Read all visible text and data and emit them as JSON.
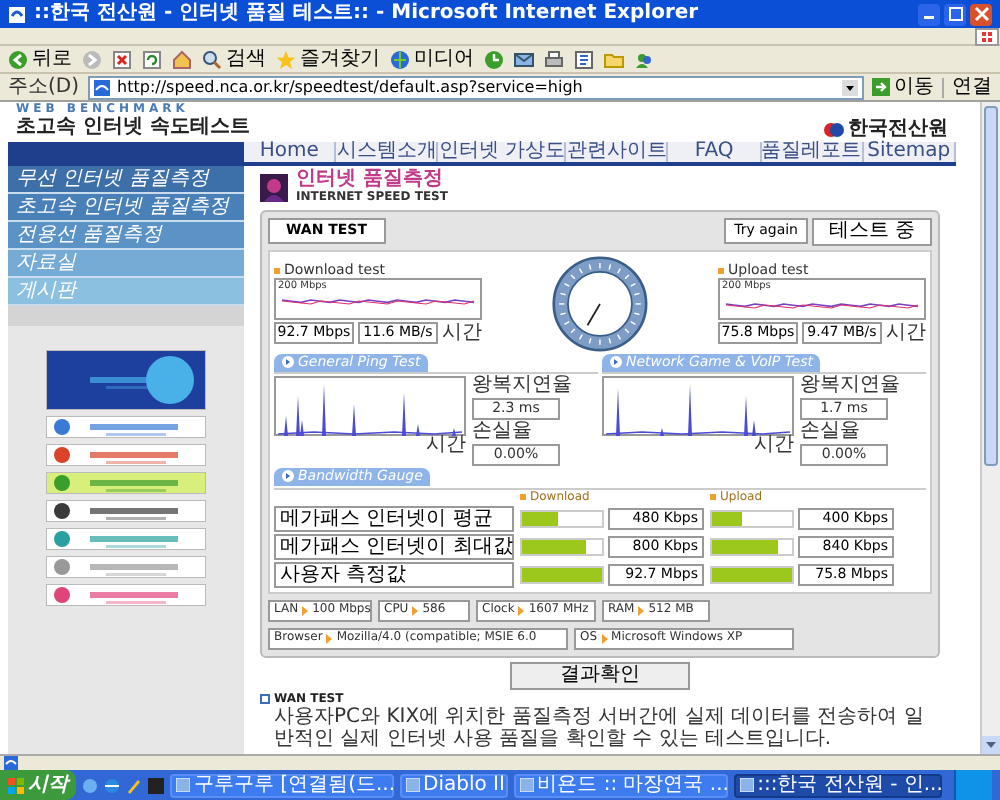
{
  "window": {
    "title": "::한국 전산원 - 인터넷 품질 테스트:: - Microsoft Internet Explorer"
  },
  "toolbar": [
    {
      "kind": "back",
      "label": "뒤로"
    },
    {
      "kind": "forward"
    },
    {
      "kind": "stop"
    },
    {
      "kind": "refresh"
    },
    {
      "kind": "home"
    },
    {
      "kind": "search",
      "label": "검색"
    },
    {
      "kind": "favorites",
      "label": "즐겨찾기"
    },
    {
      "kind": "media",
      "label": "미디어"
    },
    {
      "kind": "history"
    },
    {
      "kind": "mail"
    },
    {
      "kind": "print"
    },
    {
      "kind": "edit"
    },
    {
      "kind": "folder"
    },
    {
      "kind": "messenger"
    }
  ],
  "address_bar": {
    "label": "주소(D)",
    "url": "http://speed.nca.or.kr/speedtest/default.asp?service=high",
    "go": "이동",
    "links": "연결"
  },
  "page": {
    "header": {
      "subtitle": "WEB BENCHMARK",
      "title": "초고속 인터넷 속도테스트",
      "logo": "한국전산원"
    },
    "nav": [
      "Home",
      "시스템소개",
      "인터넷 가상도",
      "관련사이트",
      "FAQ",
      "품질레포트",
      "Sitemap"
    ],
    "sidebar": [
      "무선 인터넷 품질측정",
      "초고속 인터넷 품질측정",
      "전용선 품질측정",
      "자료실",
      "게시판"
    ],
    "main_title": "인터넷 품질측정",
    "main_subtitle": "INTERNET SPEED TEST",
    "test_panel": {
      "tab": "WAN TEST",
      "try_again": "Try again",
      "status": "테스트 중",
      "download": {
        "title": "Download test",
        "scale": "200 Mbps",
        "xlabel": "시간",
        "speed": "92.7 Mbps",
        "rate": "11.6 MB/s"
      },
      "upload": {
        "title": "Upload test",
        "scale": "200 Mbps",
        "xlabel": "시간",
        "speed": "75.8 Mbps",
        "rate": "9.47 MB/s"
      },
      "ping_tests": [
        {
          "title": "General Ping Test",
          "xlabel": "시간",
          "delay_label": "왕복지연율",
          "delay": "2.3 ms",
          "loss_label": "손실율",
          "loss": "0.00%"
        },
        {
          "title": "Network Game & VoIP Test",
          "xlabel": "시간",
          "delay_label": "왕복지연율",
          "delay": "1.7 ms",
          "loss_label": "손실율",
          "loss": "0.00%"
        }
      ],
      "bandwidth": {
        "title": "Bandwidth Gauge",
        "download_label": "Download",
        "upload_label": "Upload",
        "rows": [
          {
            "label": "메가패스 인터넷이 평균",
            "download": {
              "level": 0.45,
              "reading": "480 Kbps"
            },
            "upload": {
              "level": 0.38,
              "reading": "400 Kbps"
            }
          },
          {
            "label": "메가패스 인터넷이 최대값",
            "download": {
              "level": 0.8,
              "reading": "800 Kbps"
            },
            "upload": {
              "level": 0.82,
              "reading": "840 Kbps"
            }
          },
          {
            "label": "사용자 측정값",
            "download": {
              "level": 1,
              "reading": "92.7 Mbps"
            },
            "upload": {
              "level": 1,
              "reading": "75.8 Mbps"
            }
          }
        ]
      },
      "system_info": [
        {
          "label": "LAN",
          "value": "100 Mbps"
        },
        {
          "label": "CPU",
          "value": "586"
        },
        {
          "label": "Clock",
          "value": "1607 MHz"
        },
        {
          "label": "RAM",
          "value": "512 MB"
        },
        {
          "label": "Browser",
          "value": "Mozilla/4.0 (compatible; MSIE 6.0"
        },
        {
          "label": "OS",
          "value": "Microsoft Windows XP"
        }
      ]
    },
    "result_button": "결과확인",
    "wan_info": {
      "title": "WAN TEST",
      "text": "사용자PC와 KIX에 위치한 품질측정 서버간에 실제 데이터를 전송하여 일반적인 실제 인터넷 사용 품질을 확인할 수 있는 테스트입니다."
    }
  },
  "taskbar": {
    "start": "시작",
    "tasks": [
      {
        "label": "구루구루 [연결됨(드...",
        "selected": false
      },
      {
        "label": "Diablo II",
        "selected": false
      },
      {
        "label": "비욘드 :: 마장연국 ...",
        "selected": false
      },
      {
        "label": ":::한국 전산원 - 인...",
        "selected": true
      }
    ]
  }
}
